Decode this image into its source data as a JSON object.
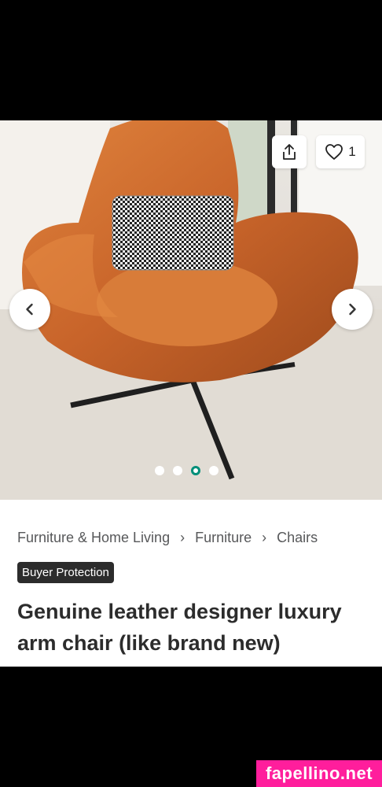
{
  "listing": {
    "like_count": "1",
    "image_carousel": {
      "total_images": 4,
      "current_index": 3
    },
    "breadcrumb": [
      "Furniture & Home Living",
      "Furniture",
      "Chairs"
    ],
    "badge": "Buyer Protection",
    "title": "Genuine leather designer luxury arm chair (like brand new)"
  },
  "icons": {
    "share": "share-icon",
    "like": "heart-icon",
    "prev": "chevron-left-icon",
    "next": "chevron-right-icon",
    "separator": "chevron-right-icon"
  },
  "colors": {
    "accent": "#008f79",
    "badge_bg": "#2c2c2c",
    "chair": "#c8642a"
  },
  "watermark": "fapellino.net"
}
